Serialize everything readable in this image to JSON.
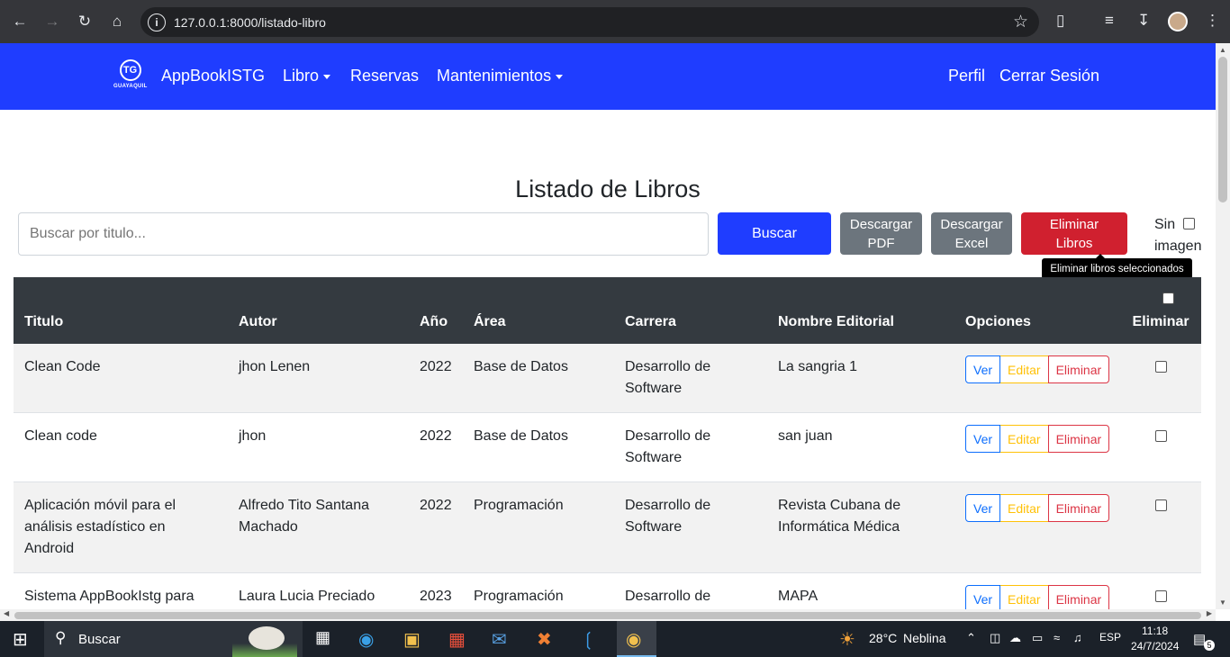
{
  "browser": {
    "url": "127.0.0.1:8000/listado-libro"
  },
  "navbar": {
    "logo_text": "GUAYAQUIL",
    "logo_mark": "TG",
    "brand": "AppBookISTG",
    "items": [
      {
        "label": "Libro",
        "dropdown": true
      },
      {
        "label": "Reservas",
        "dropdown": false
      },
      {
        "label": "Mantenimientos",
        "dropdown": true
      }
    ],
    "right": [
      {
        "label": "Perfil"
      },
      {
        "label": "Cerrar Sesión"
      }
    ],
    "color": "#1f3dff"
  },
  "main": {
    "title": "Listado de Libros",
    "search_placeholder": "Buscar por titulo...",
    "buttons": {
      "search": "Buscar",
      "pdf": "Descargar PDF",
      "excel": "Descargar Excel",
      "delete": "Eliminar Libros"
    },
    "sin_imagen": "Sin imagen",
    "tooltip": "Eliminar libros seleccionados"
  },
  "table": {
    "headers": [
      "Titulo",
      "Autor",
      "Año",
      "Área",
      "Carrera",
      "Nombre Editorial",
      "Opciones",
      "Eliminar"
    ],
    "option_labels": {
      "view": "Ver",
      "edit": "Editar",
      "delete": "Eliminar"
    },
    "rows": [
      {
        "titulo": "Clean Code",
        "autor": "jhon Lenen",
        "anio": "2022",
        "area": "Base de Datos",
        "carrera": "Desarrollo de Software",
        "editorial": "La sangria 1"
      },
      {
        "titulo": "Clean code",
        "autor": "jhon",
        "anio": "2022",
        "area": "Base de Datos",
        "carrera": "Desarrollo de Software",
        "editorial": "san juan"
      },
      {
        "titulo": "Aplicación móvil para el análisis estadístico en Android",
        "autor": "Alfredo Tito Santana Machado",
        "anio": "2022",
        "area": "Programación",
        "carrera": "Desarrollo de Software",
        "editorial": "Revista Cubana de Informática Médica"
      },
      {
        "titulo": "Sistema AppBookIstg para incremento de consultas",
        "autor": "Laura Lucia Preciado Sandoval",
        "anio": "2023",
        "area": "Programación",
        "carrera": "Desarrollo de Software",
        "editorial": "MAPA"
      }
    ]
  },
  "taskbar": {
    "search": "Buscar",
    "weather": "28°C",
    "weather_desc": "Neblina",
    "lang": "ESP",
    "time": "11:18",
    "date": "24/7/2024",
    "notifications": "5"
  }
}
